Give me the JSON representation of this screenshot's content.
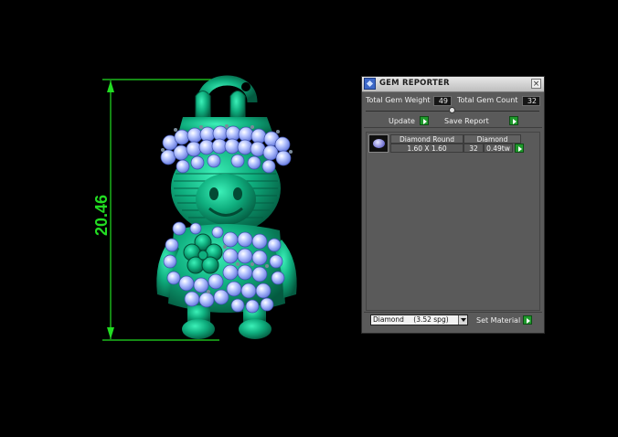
{
  "viewport": {
    "dimension_value": "20.46",
    "colors": {
      "dimension": "#22dd22",
      "model": "#0aa878",
      "gems": "#9fb4ff"
    }
  },
  "gem_reporter": {
    "title": "GEM REPORTER",
    "total_gem_weight_label": "Total Gem Weight",
    "total_gem_weight_value": "49",
    "total_gem_count_label": "Total Gem Count",
    "total_gem_count_value": "32",
    "update_label": "Update",
    "save_report_label": "Save Report",
    "table": {
      "headers": [
        "Diamond Round",
        "Diamond"
      ],
      "row": {
        "size": "1.60 X 1.60",
        "count": "32",
        "weight": "0.49tw"
      }
    },
    "material_select": {
      "value": "Diamond",
      "spg": "(3.52 spg)"
    },
    "set_material_label": "Set Material"
  }
}
